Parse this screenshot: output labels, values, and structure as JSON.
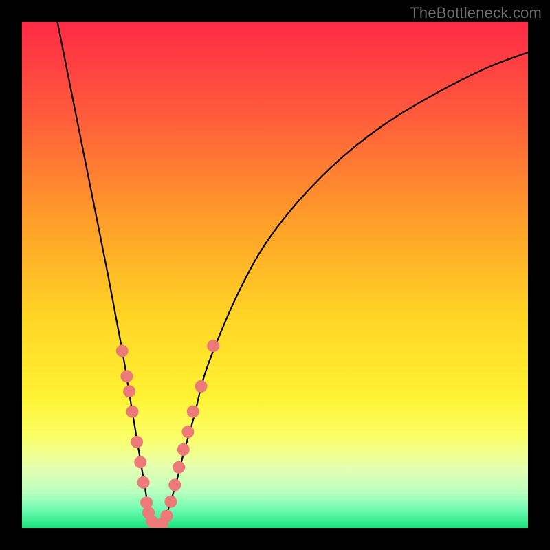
{
  "watermark": "TheBottleneck.com",
  "chart_data": {
    "type": "line",
    "title": "",
    "xlabel": "",
    "ylabel": "",
    "xlim": [
      0,
      100
    ],
    "ylim": [
      0,
      100
    ],
    "grid": false,
    "legend": false,
    "background_gradient": {
      "stops": [
        {
          "pos": 0.0,
          "color": "#ff2a46"
        },
        {
          "pos": 0.18,
          "color": "#ff5a3c"
        },
        {
          "pos": 0.38,
          "color": "#ff9a2a"
        },
        {
          "pos": 0.58,
          "color": "#ffd424"
        },
        {
          "pos": 0.74,
          "color": "#fff232"
        },
        {
          "pos": 0.82,
          "color": "#fbff66"
        },
        {
          "pos": 0.88,
          "color": "#e6ffb0"
        },
        {
          "pos": 0.93,
          "color": "#b8ffc0"
        },
        {
          "pos": 0.965,
          "color": "#6cfbb0"
        },
        {
          "pos": 1.0,
          "color": "#17e37a"
        }
      ]
    },
    "series": [
      {
        "name": "bottleneck-curve",
        "color": "#000000",
        "x": [
          7,
          9,
          11,
          13,
          15,
          17,
          18.5,
          20,
          21.3,
          22.3,
          23.3,
          24.3,
          25,
          26,
          27,
          28,
          29,
          30.5,
          32,
          34,
          36,
          39,
          43,
          48,
          55,
          63,
          72,
          82,
          92,
          100
        ],
        "y": [
          100,
          90,
          80,
          70,
          60,
          50,
          42,
          34,
          26,
          20,
          14,
          8,
          4,
          1,
          0,
          1,
          4,
          9,
          15,
          22,
          30,
          38,
          47,
          56,
          65,
          73,
          80,
          86,
          91,
          94
        ]
      }
    ],
    "scatter": {
      "name": "sample-points",
      "color": "#ec7a78",
      "points": [
        {
          "x": 19.8,
          "y": 35
        },
        {
          "x": 20.7,
          "y": 30
        },
        {
          "x": 21.2,
          "y": 27
        },
        {
          "x": 21.8,
          "y": 23
        },
        {
          "x": 22.7,
          "y": 17
        },
        {
          "x": 23.4,
          "y": 13
        },
        {
          "x": 24.0,
          "y": 9
        },
        {
          "x": 24.6,
          "y": 5
        },
        {
          "x": 25.0,
          "y": 3
        },
        {
          "x": 25.7,
          "y": 1.3
        },
        {
          "x": 26.4,
          "y": 0.6
        },
        {
          "x": 27.0,
          "y": 0.5
        },
        {
          "x": 27.7,
          "y": 0.8
        },
        {
          "x": 28.6,
          "y": 2.4
        },
        {
          "x": 29.4,
          "y": 5.2
        },
        {
          "x": 30.2,
          "y": 8.5
        },
        {
          "x": 31.0,
          "y": 12
        },
        {
          "x": 31.9,
          "y": 15.5
        },
        {
          "x": 32.8,
          "y": 19
        },
        {
          "x": 33.8,
          "y": 23
        },
        {
          "x": 35.4,
          "y": 28
        },
        {
          "x": 37.8,
          "y": 36
        }
      ]
    }
  }
}
